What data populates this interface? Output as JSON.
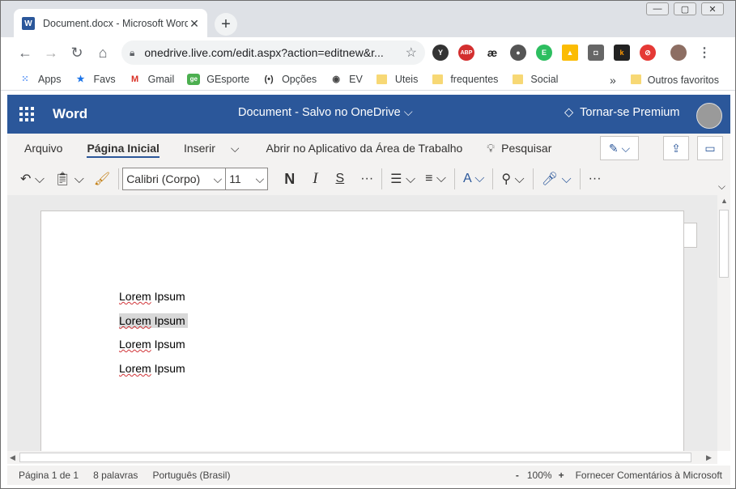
{
  "browser": {
    "tab_title": "Document.docx - Microsoft Word",
    "tab_favicon": "W",
    "new_tab": "+",
    "url": "onedrive.live.com/edit.aspx?action=editnew&r...",
    "bookmarks": [
      "Apps",
      "Favs",
      "Gmail",
      "GEsporte",
      "Opções",
      "EV",
      "Uteis",
      "frequentes",
      "Social"
    ],
    "overflow": "»",
    "other_favorites": "Outros favoritos"
  },
  "word": {
    "app_name": "Word",
    "doc_title": "Document  -  Salvo no OneDrive ⌵",
    "premium": "Tornar-se Premium",
    "accent": "#2b579a"
  },
  "menu": {
    "items": [
      "Arquivo",
      "Página Inicial",
      "Inserir"
    ],
    "open_desktop": "Abrir no Aplicativo da Área de Trabalho",
    "search": "Pesquisar"
  },
  "ribbon": {
    "font": "Calibri (Corpo)",
    "size": "11",
    "bold": "N",
    "italic": "I",
    "strike": "S",
    "more": "···"
  },
  "document": {
    "lines": [
      {
        "a": "Lorem",
        "b": " Ipsum"
      },
      {
        "a": "Lorem",
        "b": " Ipsum"
      },
      {
        "a": "Lorem",
        "b": " Ipsum"
      },
      {
        "a": "Lorem",
        "b": " Ipsum"
      }
    ]
  },
  "status": {
    "page": "Página 1 de 1",
    "words": "8 palavras",
    "language": "Português (Brasil)",
    "zoom_out": "-",
    "zoom": "100%",
    "zoom_in": "+",
    "feedback": "Fornecer Comentários à Microsoft"
  }
}
